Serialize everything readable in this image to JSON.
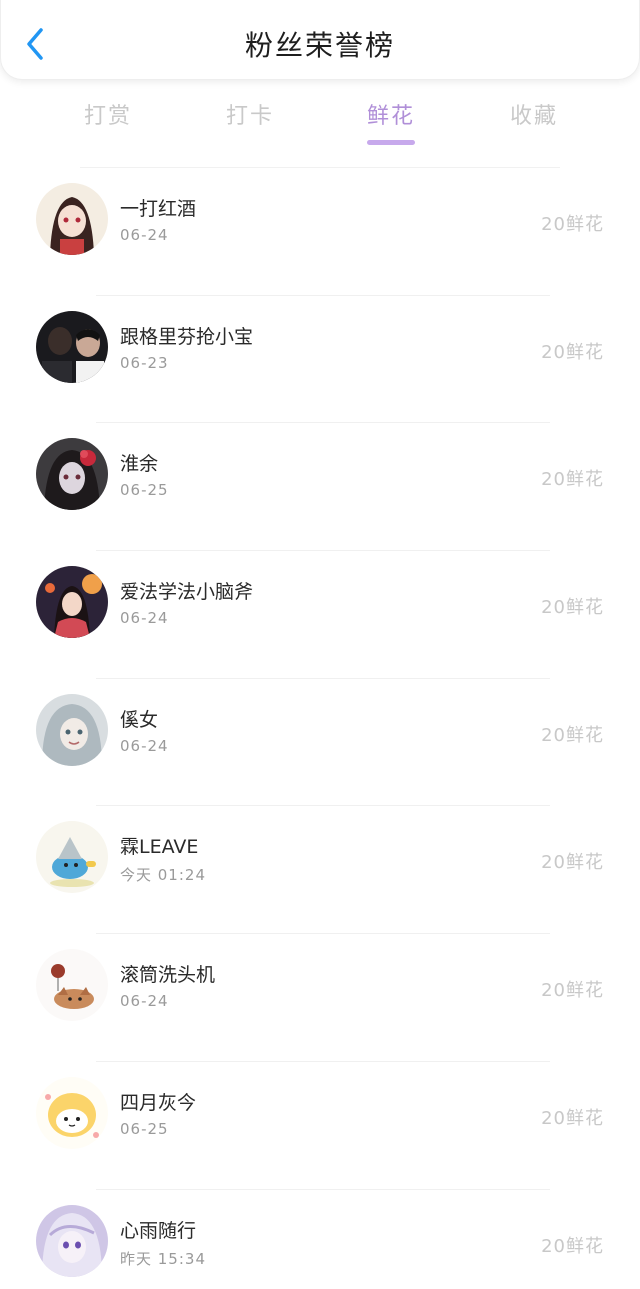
{
  "header": {
    "title": "粉丝荣誉榜",
    "back_icon": "chevron-left-icon",
    "accent": "#2196F3"
  },
  "tabs": [
    {
      "label": "打赏",
      "active": false
    },
    {
      "label": "打卡",
      "active": false
    },
    {
      "label": "鲜花",
      "active": true
    },
    {
      "label": "收藏",
      "active": false
    }
  ],
  "colors": {
    "active_tab": "#b08fd8",
    "underline": "#c7a9ec",
    "muted": "#c8c8c8"
  },
  "fans": [
    {
      "name": "一打红酒",
      "date": "06-24",
      "amount": "20鲜花"
    },
    {
      "name": "跟格里芬抢小宝",
      "date": "06-23",
      "amount": "20鲜花"
    },
    {
      "name": "淮余",
      "date": "06-25",
      "amount": "20鲜花"
    },
    {
      "name": "爱法学法小脑斧",
      "date": "06-24",
      "amount": "20鲜花"
    },
    {
      "name": "傒女",
      "date": "06-24",
      "amount": "20鲜花"
    },
    {
      "name": "霖LEAVE",
      "date": "今天 01:24",
      "amount": "20鲜花"
    },
    {
      "name": "滚筒洗头机",
      "date": "06-24",
      "amount": "20鲜花"
    },
    {
      "name": "四月灰今",
      "date": "06-25",
      "amount": "20鲜花"
    },
    {
      "name": "心雨随行",
      "date": "昨天 15:34",
      "amount": "20鲜花"
    }
  ]
}
